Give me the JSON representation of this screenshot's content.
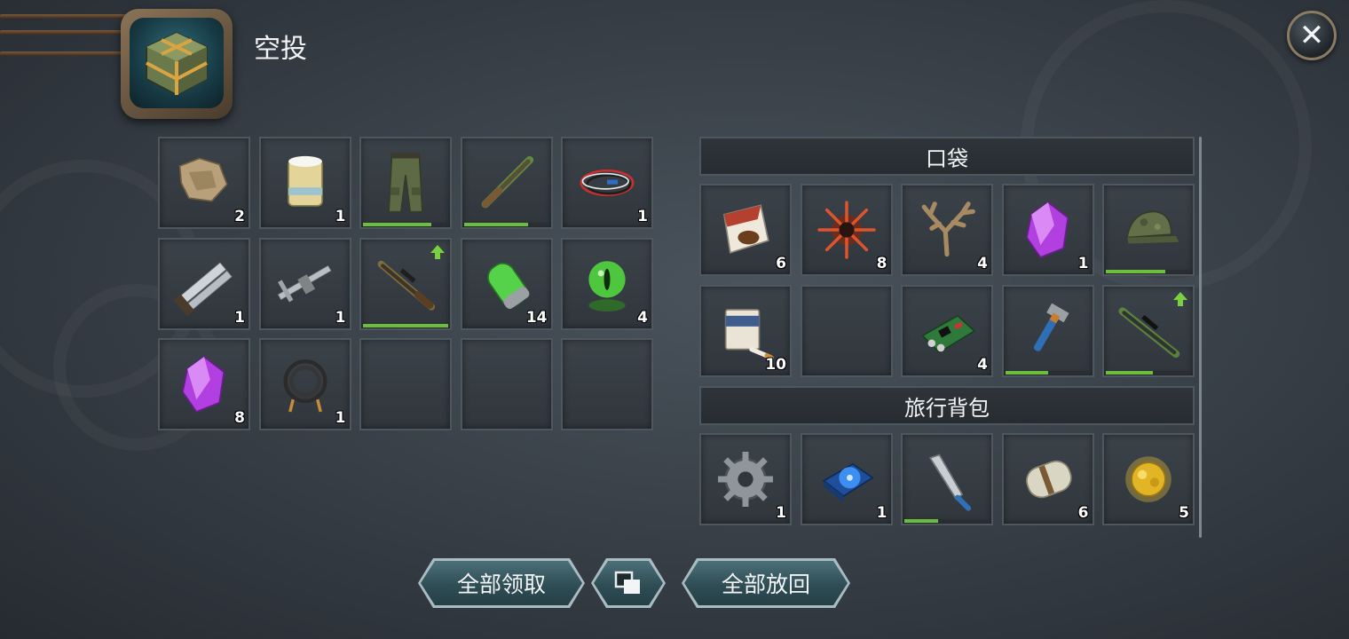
{
  "header": {
    "title": "空投"
  },
  "loot_grid": [
    {
      "name": "cloth-rags",
      "count": "2"
    },
    {
      "name": "salt-can",
      "count": "1"
    },
    {
      "name": "cargo-pants",
      "count": "",
      "durability": 0.8
    },
    {
      "name": "shotgun",
      "count": "",
      "durability": 0.75
    },
    {
      "name": "wires",
      "count": "1"
    },
    {
      "name": "hand-saw",
      "count": "1"
    },
    {
      "name": "caliper",
      "count": "1"
    },
    {
      "name": "sniper-rifle",
      "count": "",
      "durability": 1.0,
      "upgrade": true
    },
    {
      "name": "green-capsule",
      "count": "14"
    },
    {
      "name": "green-eye-orb",
      "count": "4"
    },
    {
      "name": "purple-crystal",
      "count": "8"
    },
    {
      "name": "hose",
      "count": "1"
    },
    {
      "name": "empty",
      "count": ""
    },
    {
      "name": "empty",
      "count": ""
    },
    {
      "name": "empty",
      "count": ""
    }
  ],
  "pocket": {
    "header": "口袋",
    "slots": [
      {
        "name": "tobacco-pouch",
        "count": "6"
      },
      {
        "name": "spiky-mine",
        "count": "8"
      },
      {
        "name": "antlers",
        "count": "4"
      },
      {
        "name": "purple-crystal",
        "count": "1"
      },
      {
        "name": "camo-cap",
        "count": "",
        "durability": 0.7
      },
      {
        "name": "cigarette-pack",
        "count": "10"
      },
      {
        "name": "empty",
        "count": ""
      },
      {
        "name": "circuit-board",
        "count": "4"
      },
      {
        "name": "pipe-wrench",
        "count": "",
        "durability": 0.5
      },
      {
        "name": "green-sniper-rifle",
        "count": "",
        "durability": 0.55,
        "upgrade": true
      }
    ]
  },
  "backpack": {
    "header": "旅行背包",
    "slots": [
      {
        "name": "gear",
        "count": "1"
      },
      {
        "name": "blue-hard-drive",
        "count": "1"
      },
      {
        "name": "machete",
        "count": "",
        "durability": 0.4
      },
      {
        "name": "cash-roll",
        "count": "6"
      },
      {
        "name": "gold-nugget",
        "count": "5"
      }
    ]
  },
  "buttons": {
    "take_all": "全部领取",
    "put_back_all": "全部放回"
  },
  "colors": {
    "durability": "#6bbf3c",
    "upgrade": "#7ad13f",
    "button": "#2f4d55"
  }
}
